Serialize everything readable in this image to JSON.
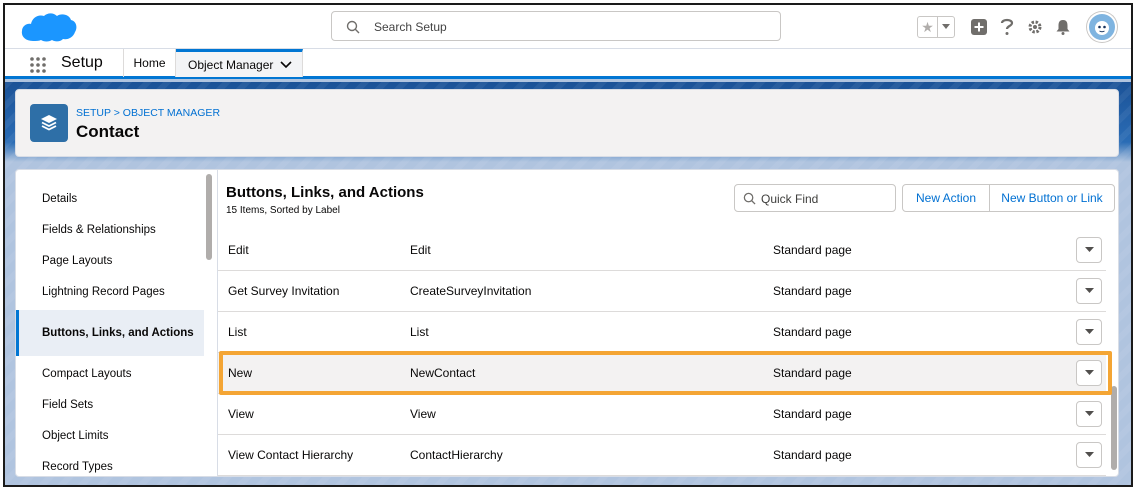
{
  "header": {
    "search_placeholder": "Search Setup"
  },
  "app_nav": {
    "app_name": "Setup",
    "tabs": [
      {
        "label": "Home"
      },
      {
        "label": "Object Manager"
      }
    ]
  },
  "page_header": {
    "breadcrumb": "SETUP > OBJECT MANAGER",
    "title": "Contact"
  },
  "sidebar": {
    "items": [
      {
        "label": "Details"
      },
      {
        "label": "Fields & Relationships"
      },
      {
        "label": "Page Layouts"
      },
      {
        "label": "Lightning Record Pages"
      },
      {
        "label": "Buttons, Links, and Actions"
      },
      {
        "label": "Compact Layouts"
      },
      {
        "label": "Field Sets"
      },
      {
        "label": "Object Limits"
      },
      {
        "label": "Record Types"
      }
    ],
    "active_index": 4
  },
  "main": {
    "title": "Buttons, Links, and Actions",
    "subtitle": "15 Items, Sorted by Label",
    "quick_find_placeholder": "Quick Find",
    "buttons": {
      "new_action": "New Action",
      "new_button_or_link": "New Button or Link"
    },
    "rows": [
      {
        "label": "Edit",
        "name": "Edit",
        "type": "Standard page"
      },
      {
        "label": "Get Survey Invitation",
        "name": "CreateSurveyInvitation",
        "type": "Standard page"
      },
      {
        "label": "List",
        "name": "List",
        "type": "Standard page"
      },
      {
        "label": "New",
        "name": "NewContact",
        "type": "Standard page"
      },
      {
        "label": "View",
        "name": "View",
        "type": "Standard page"
      },
      {
        "label": "View Contact Hierarchy",
        "name": "ContactHierarchy",
        "type": "Standard page"
      }
    ],
    "highlighted_row_index": 3
  },
  "colors": {
    "brand_blue": "#0176d3",
    "link_blue": "#0070d2",
    "highlight": "#f4a534"
  }
}
